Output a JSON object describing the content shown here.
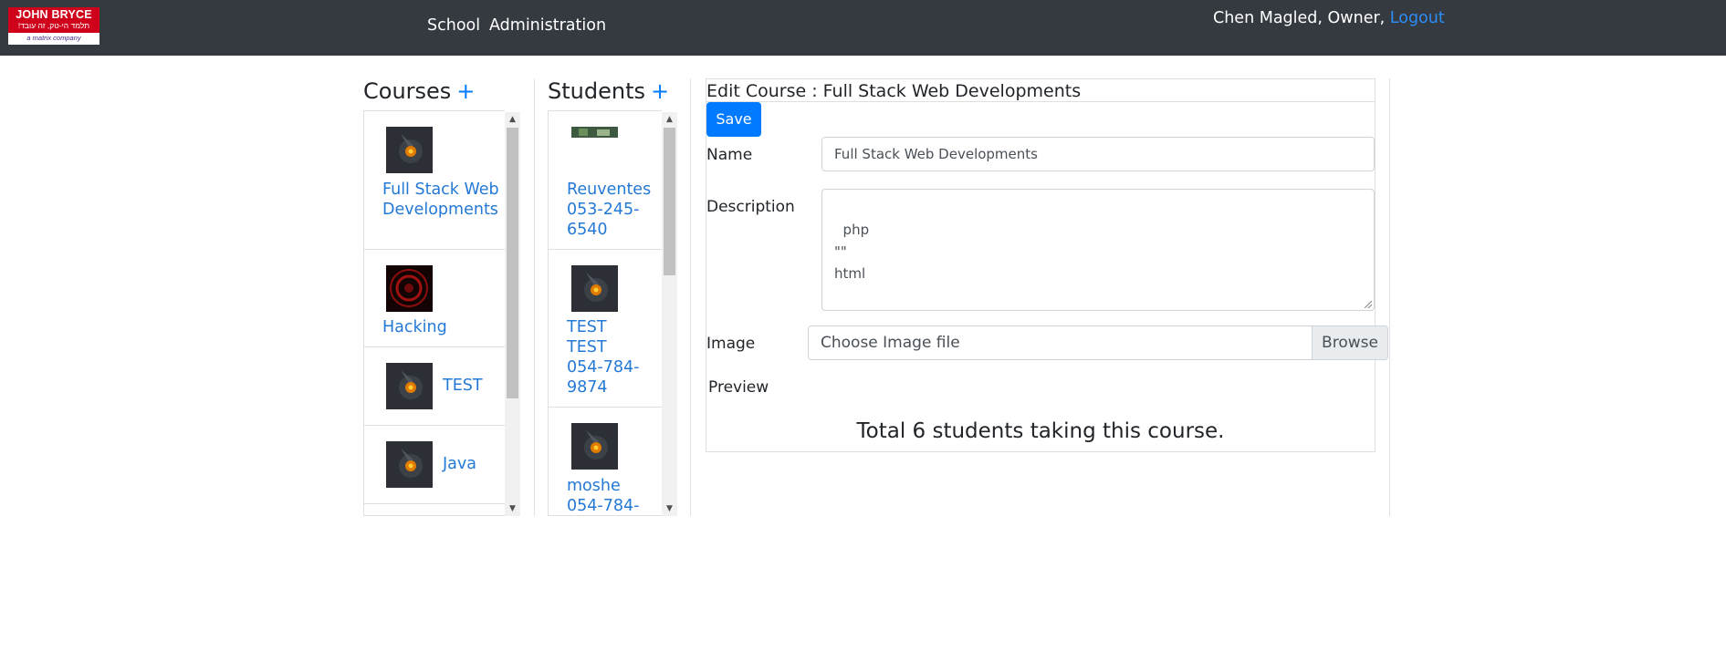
{
  "navbar": {
    "logo": {
      "brand": "JOHN BRYCE",
      "slogan": "תלמד הי-טק, זה עובד!",
      "tag": "a matrix company"
    },
    "links": {
      "school": "School",
      "administration": "Administration"
    },
    "user": {
      "greeting": "Chen Magled, Owner, ",
      "logout": "Logout"
    }
  },
  "courses": {
    "title": "Courses",
    "add": "+",
    "items": [
      {
        "name": "Full Stack Web Developments",
        "image": "dark-gear-thumbnail"
      },
      {
        "name": "Hacking",
        "image": "red-target-thumbnail"
      },
      {
        "name": "TEST",
        "image": "dark-gear-thumbnail"
      },
      {
        "name": "Java",
        "image": "dark-gear-thumbnail"
      }
    ]
  },
  "students": {
    "title": "Students",
    "add": "+",
    "items": [
      {
        "line1": "Reuventes",
        "line2": "053-245-",
        "line3": "6540",
        "image": "green-photo-thumbnail"
      },
      {
        "line1": "TEST",
        "line2": "TEST",
        "line3": "054-784-",
        "line4": "9874",
        "image": "dark-gear-thumbnail"
      },
      {
        "line1": "moshe",
        "line2": "054-784-",
        "image": "dark-gear-thumbnail"
      }
    ]
  },
  "edit": {
    "title": "Edit Course : Full Stack Web Developments",
    "save": "Save",
    "name_label": "Name",
    "name_value": "Full Stack Web Developments",
    "description_label": "Description",
    "description_value": "php\n\"\"\nhtml",
    "image_label": "Image",
    "file_placeholder": "Choose Image file",
    "browse": "Browse",
    "preview_label": "Preview",
    "total": "Total 6 students taking this course."
  },
  "colors": {
    "navbar": "#343a40",
    "link": "#2479d6",
    "primary": "#007bff"
  }
}
